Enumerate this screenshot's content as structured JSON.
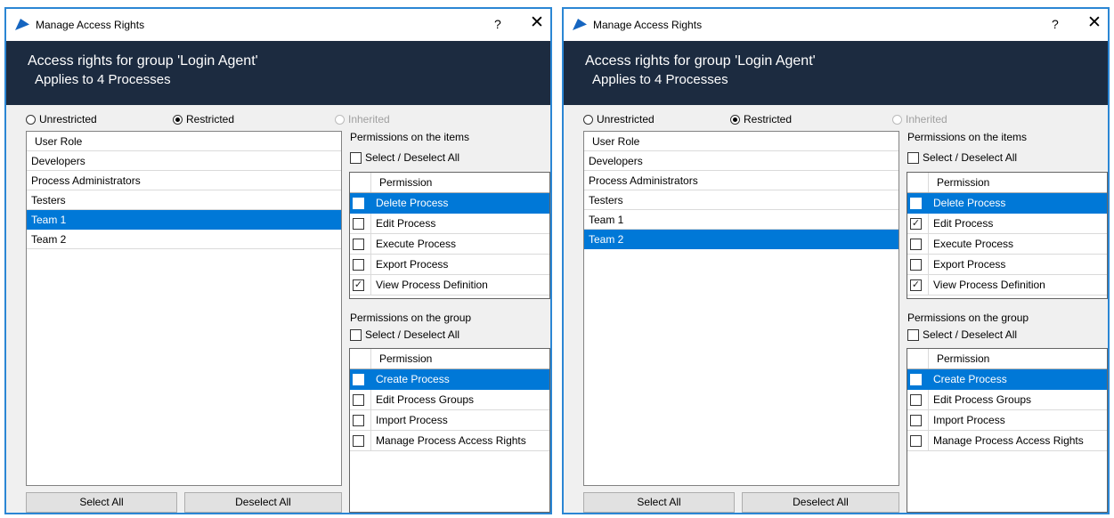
{
  "windows": [
    {
      "title": "Manage Access Rights",
      "help_label": "?",
      "close_label": "✕",
      "banner_line1": "Access rights for group 'Login Agent'",
      "banner_line2": "Applies to 4 Processes",
      "radios": [
        {
          "label": "Unrestricted",
          "checked": false,
          "disabled": false
        },
        {
          "label": "Restricted",
          "checked": true,
          "disabled": false
        },
        {
          "label": "Inherited",
          "checked": false,
          "disabled": true
        }
      ],
      "roles_header": "User Role",
      "roles": [
        {
          "label": "Developers",
          "selected": false
        },
        {
          "label": "Process Administrators",
          "selected": false
        },
        {
          "label": "Testers",
          "selected": false
        },
        {
          "label": "Team 1",
          "selected": true
        },
        {
          "label": "Team 2",
          "selected": false
        }
      ],
      "select_all_button": "Select All",
      "deselect_all_button": "Deselect All",
      "items_section": {
        "label": "Permissions on the items",
        "select_deselect_label": "Select / Deselect All",
        "select_deselect_checked": false,
        "column_header": "Permission",
        "rows": [
          {
            "label": "Delete Process",
            "checked": false,
            "selected": true
          },
          {
            "label": "Edit Process",
            "checked": false,
            "selected": false
          },
          {
            "label": "Execute Process",
            "checked": false,
            "selected": false
          },
          {
            "label": "Export Process",
            "checked": false,
            "selected": false
          },
          {
            "label": "View Process Definition",
            "checked": true,
            "selected": false
          }
        ]
      },
      "group_section": {
        "label": "Permissions on the group",
        "select_deselect_label": "Select / Deselect All",
        "select_deselect_checked": false,
        "column_header": "Permission",
        "rows": [
          {
            "label": "Create Process",
            "checked": false,
            "selected": true
          },
          {
            "label": "Edit Process Groups",
            "checked": false,
            "selected": false
          },
          {
            "label": "Import Process",
            "checked": false,
            "selected": false
          },
          {
            "label": "Manage Process Access Rights",
            "checked": false,
            "selected": false
          }
        ]
      }
    },
    {
      "title": "Manage Access Rights",
      "help_label": "?",
      "close_label": "✕",
      "banner_line1": "Access rights for group 'Login Agent'",
      "banner_line2": "Applies to 4 Processes",
      "radios": [
        {
          "label": "Unrestricted",
          "checked": false,
          "disabled": false
        },
        {
          "label": "Restricted",
          "checked": true,
          "disabled": false
        },
        {
          "label": "Inherited",
          "checked": false,
          "disabled": true
        }
      ],
      "roles_header": "User Role",
      "roles": [
        {
          "label": "Developers",
          "selected": false
        },
        {
          "label": "Process Administrators",
          "selected": false
        },
        {
          "label": "Testers",
          "selected": false
        },
        {
          "label": "Team 1",
          "selected": false
        },
        {
          "label": "Team 2",
          "selected": true
        }
      ],
      "select_all_button": "Select All",
      "deselect_all_button": "Deselect All",
      "items_section": {
        "label": "Permissions on the items",
        "select_deselect_label": "Select / Deselect All",
        "select_deselect_checked": false,
        "column_header": "Permission",
        "rows": [
          {
            "label": "Delete Process",
            "checked": false,
            "selected": true
          },
          {
            "label": "Edit Process",
            "checked": true,
            "selected": false
          },
          {
            "label": "Execute Process",
            "checked": false,
            "selected": false
          },
          {
            "label": "Export Process",
            "checked": false,
            "selected": false
          },
          {
            "label": "View Process Definition",
            "checked": true,
            "selected": false
          }
        ]
      },
      "group_section": {
        "label": "Permissions on the group",
        "select_deselect_label": "Select / Deselect All",
        "select_deselect_checked": false,
        "column_header": "Permission",
        "rows": [
          {
            "label": "Create Process",
            "checked": false,
            "selected": true
          },
          {
            "label": "Edit Process Groups",
            "checked": false,
            "selected": false
          },
          {
            "label": "Import Process",
            "checked": false,
            "selected": false
          },
          {
            "label": "Manage Process Access Rights",
            "checked": false,
            "selected": false
          }
        ]
      }
    }
  ],
  "colors": {
    "window_border": "#2b86d4",
    "banner": "#1c2b40",
    "selection": "#0078d7",
    "app_icon": "#1565c0"
  }
}
